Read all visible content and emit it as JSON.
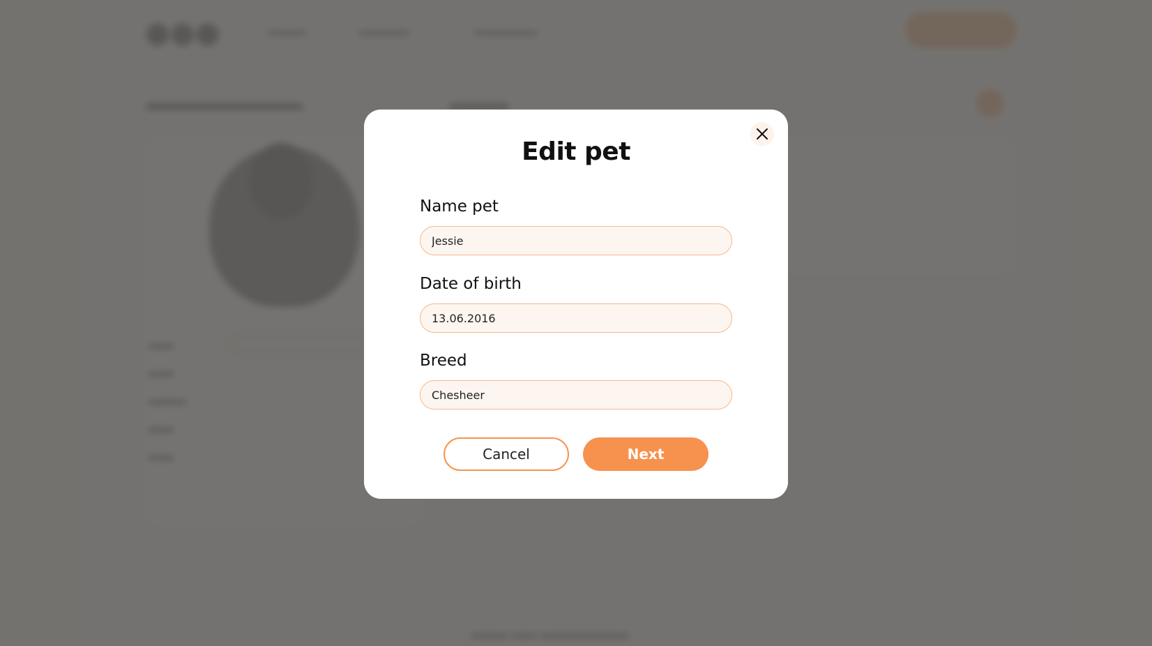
{
  "modal": {
    "title": "Edit pet",
    "fields": [
      {
        "label": "Name pet",
        "value": "Jessie"
      },
      {
        "label": "Date of birth",
        "value": "13.06.2016"
      },
      {
        "label": "Breed",
        "value": "Chesheer"
      }
    ],
    "cancel_label": "Cancel",
    "next_label": "Next",
    "close_icon": "close-icon"
  },
  "colors": {
    "accent": "#f6924e",
    "input_bg": "#fdf6f0",
    "overlay": "#61605d"
  }
}
